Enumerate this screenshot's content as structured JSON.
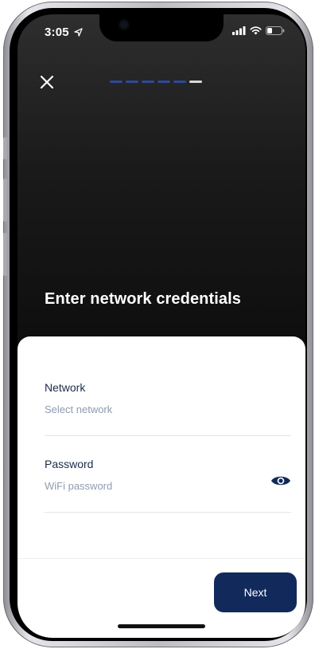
{
  "status_bar": {
    "time": "3:05"
  },
  "header": {
    "progress": {
      "total_steps": 6,
      "completed_steps": 5
    }
  },
  "main": {
    "title": "Enter network credentials"
  },
  "form": {
    "network": {
      "label": "Network",
      "placeholder": "Select network"
    },
    "password": {
      "label": "Password",
      "placeholder": "WiFi password"
    }
  },
  "footer": {
    "next_label": "Next"
  },
  "colors": {
    "accent": "#122a5b",
    "progress_done": "#2d4a9a",
    "progress_pending": "#d9d9d9",
    "label": "#1c2b4a",
    "placeholder": "#8f9bb0"
  },
  "icons": {
    "close": "close-icon",
    "visibility": "eye-icon",
    "location": "location-arrow-icon",
    "signal": "cellular-signal-icon",
    "wifi": "wifi-icon",
    "battery": "battery-icon"
  }
}
